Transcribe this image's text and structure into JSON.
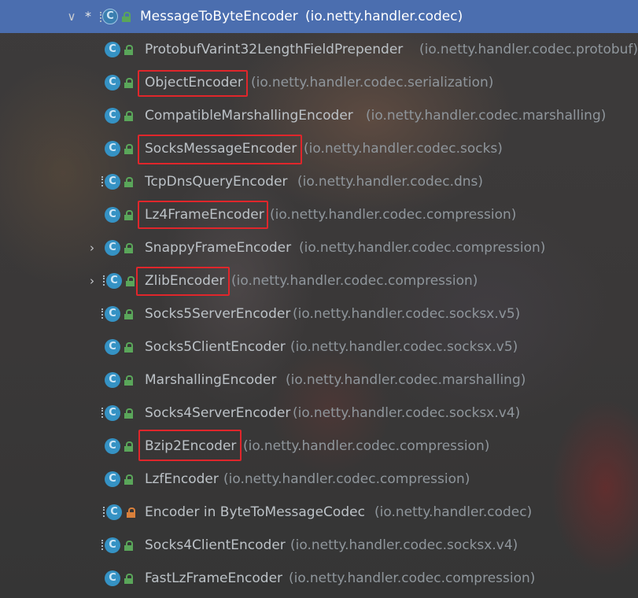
{
  "tree": {
    "root": {
      "name": "MessageToByteEncoder",
      "package": "(io.netty.handler.codec)",
      "expanded": true,
      "marker": "*"
    },
    "children": [
      {
        "name": "ProtobufVarint32LengthFieldPrepender",
        "package": "(io.netty.handler.codec.protobuf)",
        "icon": "class-icon",
        "access": "public"
      },
      {
        "name": "ObjectEncoder",
        "package": "(io.netty.handler.codec.serialization)",
        "icon": "class-icon",
        "access": "public",
        "highlighted": true
      },
      {
        "name": "CompatibleMarshallingEncoder",
        "package": "(io.netty.handler.codec.marshalling)",
        "icon": "class-icon",
        "access": "public"
      },
      {
        "name": "SocksMessageEncoder",
        "package": "(io.netty.handler.codec.socks)",
        "icon": "class-icon",
        "access": "public",
        "highlighted": true
      },
      {
        "name": "TcpDnsQueryEncoder",
        "package": "(io.netty.handler.codec.dns)",
        "icon": "class-icon",
        "access": "public"
      },
      {
        "name": "Lz4FrameEncoder",
        "package": "(io.netty.handler.codec.compression)",
        "icon": "class-icon",
        "access": "public",
        "highlighted": true
      },
      {
        "name": "SnappyFrameEncoder",
        "package": "(io.netty.handler.codec.compression)",
        "icon": "class-icon",
        "access": "public",
        "expandable": true
      },
      {
        "name": "ZlibEncoder",
        "package": "(io.netty.handler.codec.compression)",
        "icon": "abstract-class-icon",
        "access": "public",
        "expandable": true,
        "highlighted": true
      },
      {
        "name": "Socks5ServerEncoder",
        "package": "(io.netty.handler.codec.socksx.v5)",
        "icon": "class-icon",
        "access": "public"
      },
      {
        "name": "Socks5ClientEncoder",
        "package": "(io.netty.handler.codec.socksx.v5)",
        "icon": "class-icon",
        "access": "public"
      },
      {
        "name": "MarshallingEncoder",
        "package": "(io.netty.handler.codec.marshalling)",
        "icon": "class-icon",
        "access": "public"
      },
      {
        "name": "Socks4ServerEncoder",
        "package": "(io.netty.handler.codec.socksx.v4)",
        "icon": "class-icon",
        "access": "public"
      },
      {
        "name": "Bzip2Encoder",
        "package": "(io.netty.handler.codec.compression)",
        "icon": "class-icon",
        "access": "public",
        "highlighted": true
      },
      {
        "name": "LzfEncoder",
        "package": "(io.netty.handler.codec.compression)",
        "icon": "class-icon",
        "access": "public"
      },
      {
        "name": "Encoder in ByteToMessageCodec",
        "package": "(io.netty.handler.codec)",
        "icon": "class-icon",
        "access": "private"
      },
      {
        "name": "Socks4ClientEncoder",
        "package": "(io.netty.handler.codec.socksx.v4)",
        "icon": "class-icon",
        "access": "public"
      },
      {
        "name": "FastLzFrameEncoder",
        "package": "(io.netty.handler.codec.compression)",
        "icon": "class-icon",
        "access": "public"
      }
    ]
  },
  "icon_glyphs": {
    "class_letter": "C",
    "expanded_arrow": "∨",
    "collapsed_arrow": "›"
  },
  "colors": {
    "selection": "#4b6eaf",
    "class_icon": "#3592c4",
    "public_lock": "#5aa65a",
    "private_lock": "#d9803b",
    "highlight_box": "#e0262b",
    "name_text": "#bcc2c7",
    "package_text": "#8f969c"
  }
}
